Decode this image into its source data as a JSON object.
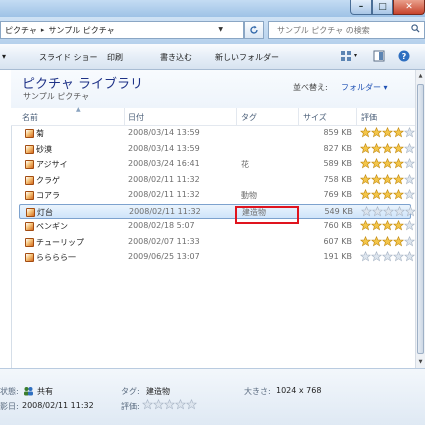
{
  "titlebar": {
    "min_glyph": "–",
    "max_glyph": "□",
    "close_glyph": "✕"
  },
  "address": {
    "crumbs": [
      "ピクチャ",
      "サンプル ピクチャ"
    ],
    "separator": "▸",
    "search_placeholder": "サンプル ピクチャ の検索"
  },
  "toolbar": {
    "items": [
      "スライド ショー",
      "印刷",
      "書き込む",
      "新しいフォルダー"
    ],
    "arrow": "▾"
  },
  "library": {
    "title": "ピクチャ ライブラリ",
    "subtitle": "サンプル ピクチャ",
    "arrange_label": "並べ替え:",
    "arrange_value": "フォルダー ▾"
  },
  "columns": {
    "name": "名前",
    "date": "日付",
    "tag": "タグ",
    "size": "サイズ",
    "rating": "評価"
  },
  "files": [
    {
      "name": "菊",
      "date": "2008/03/14 13:59",
      "tag": "",
      "size": "859 KB",
      "rating": 4
    },
    {
      "name": "砂漠",
      "date": "2008/03/14 13:59",
      "tag": "",
      "size": "827 KB",
      "rating": 4
    },
    {
      "name": "アジサイ",
      "date": "2008/03/24 16:41",
      "tag": "花",
      "size": "589 KB",
      "rating": 4
    },
    {
      "name": "クラゲ",
      "date": "2008/02/11 11:32",
      "tag": "",
      "size": "758 KB",
      "rating": 4
    },
    {
      "name": "コアラ",
      "date": "2008/02/11 11:32",
      "tag": "動物",
      "size": "769 KB",
      "rating": 4
    },
    {
      "name": "灯台",
      "date": "2008/02/11 11:32",
      "tag": "建造物",
      "size": "549 KB",
      "rating": 0,
      "selected": true
    },
    {
      "name": "ペンギン",
      "date": "2008/02/18 5:07",
      "tag": "",
      "size": "760 KB",
      "rating": 4
    },
    {
      "name": "チューリップ",
      "date": "2008/02/07 11:33",
      "tag": "",
      "size": "607 KB",
      "rating": 4
    },
    {
      "name": "らららら一",
      "date": "2009/06/25 13:07",
      "tag": "",
      "size": "191 KB",
      "rating": 0
    }
  ],
  "details": {
    "state_label": "状態:",
    "state_value": "共有",
    "date_label": "影日:",
    "date_value": "2008/02/11 11:32",
    "tag_label": "タグ:",
    "tag_value": "建造物",
    "rating_label": "評価:",
    "size_label": "大きさ:",
    "size_value": "1024 x 768"
  },
  "colors": {
    "star_filled": "#f4c64a",
    "star_empty": "#dde5ee",
    "highlight": "#e0141e",
    "title_text": "#1e3287"
  }
}
